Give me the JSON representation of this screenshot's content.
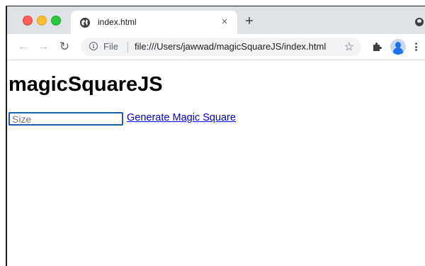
{
  "browser": {
    "tab": {
      "title": "index.html",
      "favicon": "globe-icon",
      "close_label": "×"
    },
    "new_tab_label": "+",
    "address_bar": {
      "scheme_label": "File",
      "url": "file:///Users/jawwad/magicSquareJS/index.html"
    },
    "icons": {
      "back": "arrow-left-icon",
      "forward": "arrow-right-icon",
      "reload": "reload-icon",
      "info": "info-icon",
      "bookmark": "star-icon",
      "extensions": "puzzle-icon",
      "avatar": "avatar",
      "menu": "kebab-menu-icon"
    },
    "colors": {
      "tabstrip": "#dee1e6",
      "omnibox": "#f1f3f4",
      "close": "#fe5f57",
      "minimize": "#febc2e",
      "maximize": "#28c840"
    }
  },
  "page": {
    "heading": "magicSquareJS",
    "size_input": {
      "placeholder": "Size",
      "value": ""
    },
    "generate_link": "Generate Magic Square",
    "colors": {
      "link": "#0000ee",
      "input_focus_border": "#1a5fb4"
    }
  }
}
